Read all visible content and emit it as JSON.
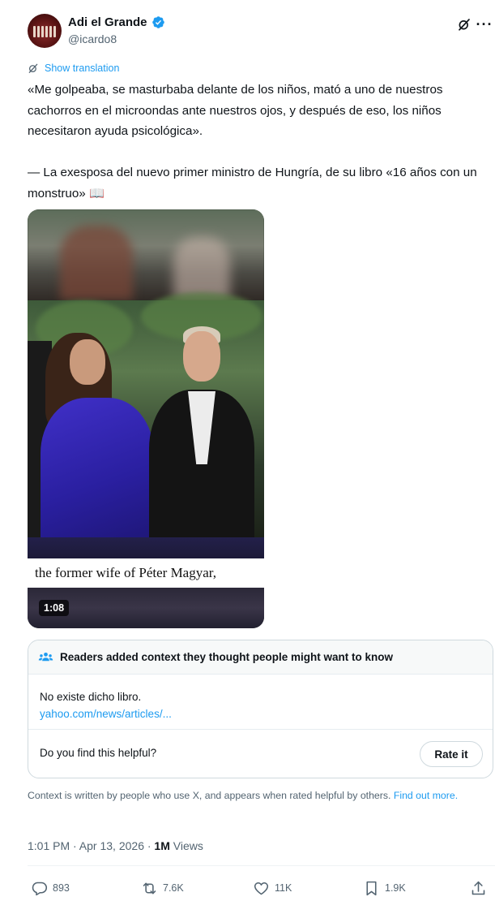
{
  "author": {
    "name": "Adi el Grande",
    "handle": "@icardo8",
    "verified": true,
    "avatar_icon": "avatar-image"
  },
  "header_icons": [
    "grok-icon",
    "more-icon"
  ],
  "translate_label": "Show translation",
  "tweet_text": "«Me golpeaba, se masturbaba delante de los niños, mató a uno de nuestros cachorros en el microondas ante nuestros ojos, y después de eso, los niños necesitaron ayuda psicológica».\n\n— La exesposa del nuevo primer ministro de Hungría, de su libro «16 años con un monstruo» 📖",
  "video": {
    "caption": "the former wife of Péter Magyar,",
    "duration": "1:08"
  },
  "community_note": {
    "title": "Readers added context they thought people might want to know",
    "body": "No existe dicho libro.",
    "link": "yahoo.com/news/articles/...",
    "helpful_question": "Do you find this helpful?",
    "rate_button": "Rate it"
  },
  "context_info": {
    "text": "Context is written by people who use X, and appears when rated helpful by others. ",
    "link": "Find out more."
  },
  "timestamp": {
    "time": "1:01 PM · Apr 13, 2026 · ",
    "views_count": "1M",
    "views_label": " Views"
  },
  "actions": {
    "replies": "893",
    "reposts": "7.6K",
    "likes": "11K",
    "bookmarks": "1.9K"
  },
  "colors": {
    "accent": "#1d9bf0",
    "text": "#0f1419",
    "secondary": "#536471",
    "border": "#cfd9de"
  }
}
